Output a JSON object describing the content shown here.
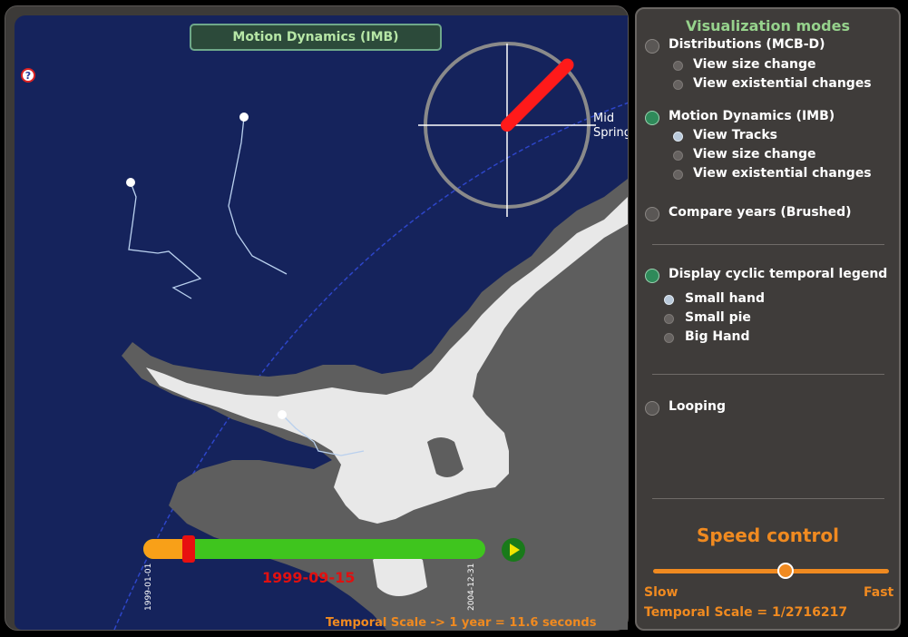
{
  "map": {
    "mode_title": "Motion Dynamics (IMB)",
    "help_icon": "help-icon",
    "season_label_line1": "Mid",
    "season_label_line2": "Spring",
    "clock_hand_angle_deg": 45,
    "timeline": {
      "start_date": "1999-01-01",
      "end_date": "2004-12-31",
      "current_date": "1999-09-15",
      "progress_fraction": 0.133
    },
    "temporal_scale_text": "Temporal Scale -> 1 year = 11.6 seconds",
    "colors": {
      "ocean": "#15235c",
      "land": "#5e5e5e",
      "ice": "#e8e8e8",
      "elapsed": "#f8a018",
      "remaining": "#3fc51e",
      "thumb": "#e81010",
      "clock_hand": "#ff1a1a"
    }
  },
  "panel": {
    "title": "Visualization modes",
    "distributions": {
      "label": "Distributions (MCB-D)",
      "selected": false,
      "sub": [
        {
          "label": "View size change",
          "selected": false
        },
        {
          "label": "View existential changes",
          "selected": false
        }
      ]
    },
    "motion": {
      "label": "Motion Dynamics (IMB)",
      "selected": true,
      "sub": [
        {
          "label": "View Tracks",
          "selected": true
        },
        {
          "label": "View size change",
          "selected": false
        },
        {
          "label": "View existential changes",
          "selected": false
        }
      ]
    },
    "compare": {
      "label": "Compare years (Brushed)",
      "selected": false
    },
    "legend": {
      "label": "Display cyclic temporal legend",
      "selected": true,
      "sub": [
        {
          "label": "Small hand",
          "selected": true
        },
        {
          "label": "Small pie",
          "selected": false
        },
        {
          "label": "Big Hand",
          "selected": false
        }
      ]
    },
    "looping": {
      "label": "Looping",
      "selected": false
    },
    "speed": {
      "title": "Speed control",
      "slow_label": "Slow",
      "fast_label": "Fast",
      "value_fraction": 0.56,
      "temporal_scale_text": "Temporal Scale = 1/2716217"
    }
  }
}
